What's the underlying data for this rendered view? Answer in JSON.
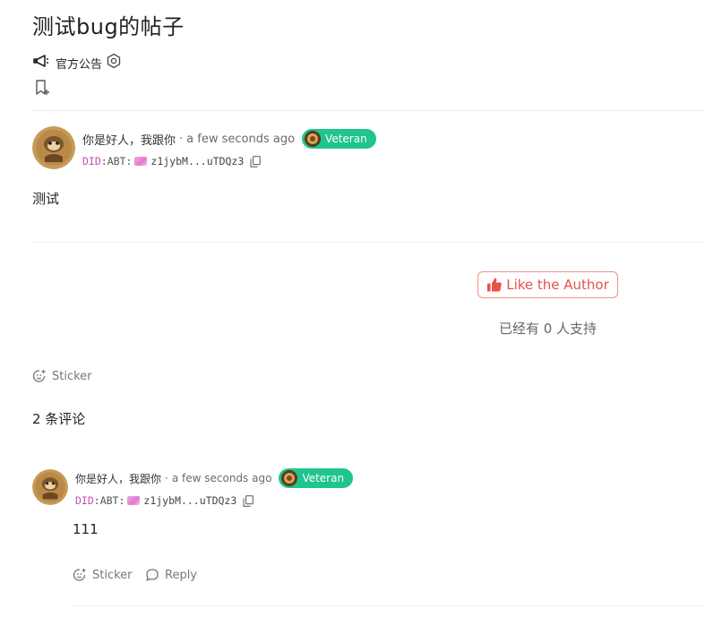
{
  "post": {
    "title": "测试bug的帖子",
    "category": "官方公告",
    "author": "你是好人，我跟你",
    "separator": "·",
    "time": "a few seconds ago",
    "badge": "Veteran",
    "did_prefix": "DID",
    "did_mid": ":ABT:",
    "did_value": "z1jybM...uTDQz3",
    "body": "测试"
  },
  "like": {
    "button_label": "Like the Author",
    "supporters_text": "已经有 0 人支持"
  },
  "sticker_label": "Sticker",
  "comments": {
    "count_label": "2 条评论",
    "items": [
      {
        "author": "你是好人，我跟你",
        "separator": "·",
        "time": "a few seconds ago",
        "badge": "Veteran",
        "did_prefix": "DID",
        "did_mid": ":ABT:",
        "did_value": "z1jybM...uTDQz3",
        "body": "111",
        "sticker_label": "Sticker",
        "reply_label": "Reply"
      }
    ]
  },
  "icons": {
    "megaphone": "megaphone-icon",
    "settings": "hexagon-gear-icon",
    "bookmark": "bookmark-add-icon",
    "copy": "copy-icon",
    "thumb": "thumbs-up-icon",
    "sticker": "sticker-add-icon",
    "reply": "chat-bubble-icon"
  },
  "colors": {
    "accent_like": "#e5534b",
    "badge_bg": "#1fc48e",
    "did_prefix": "#c64fb2"
  }
}
